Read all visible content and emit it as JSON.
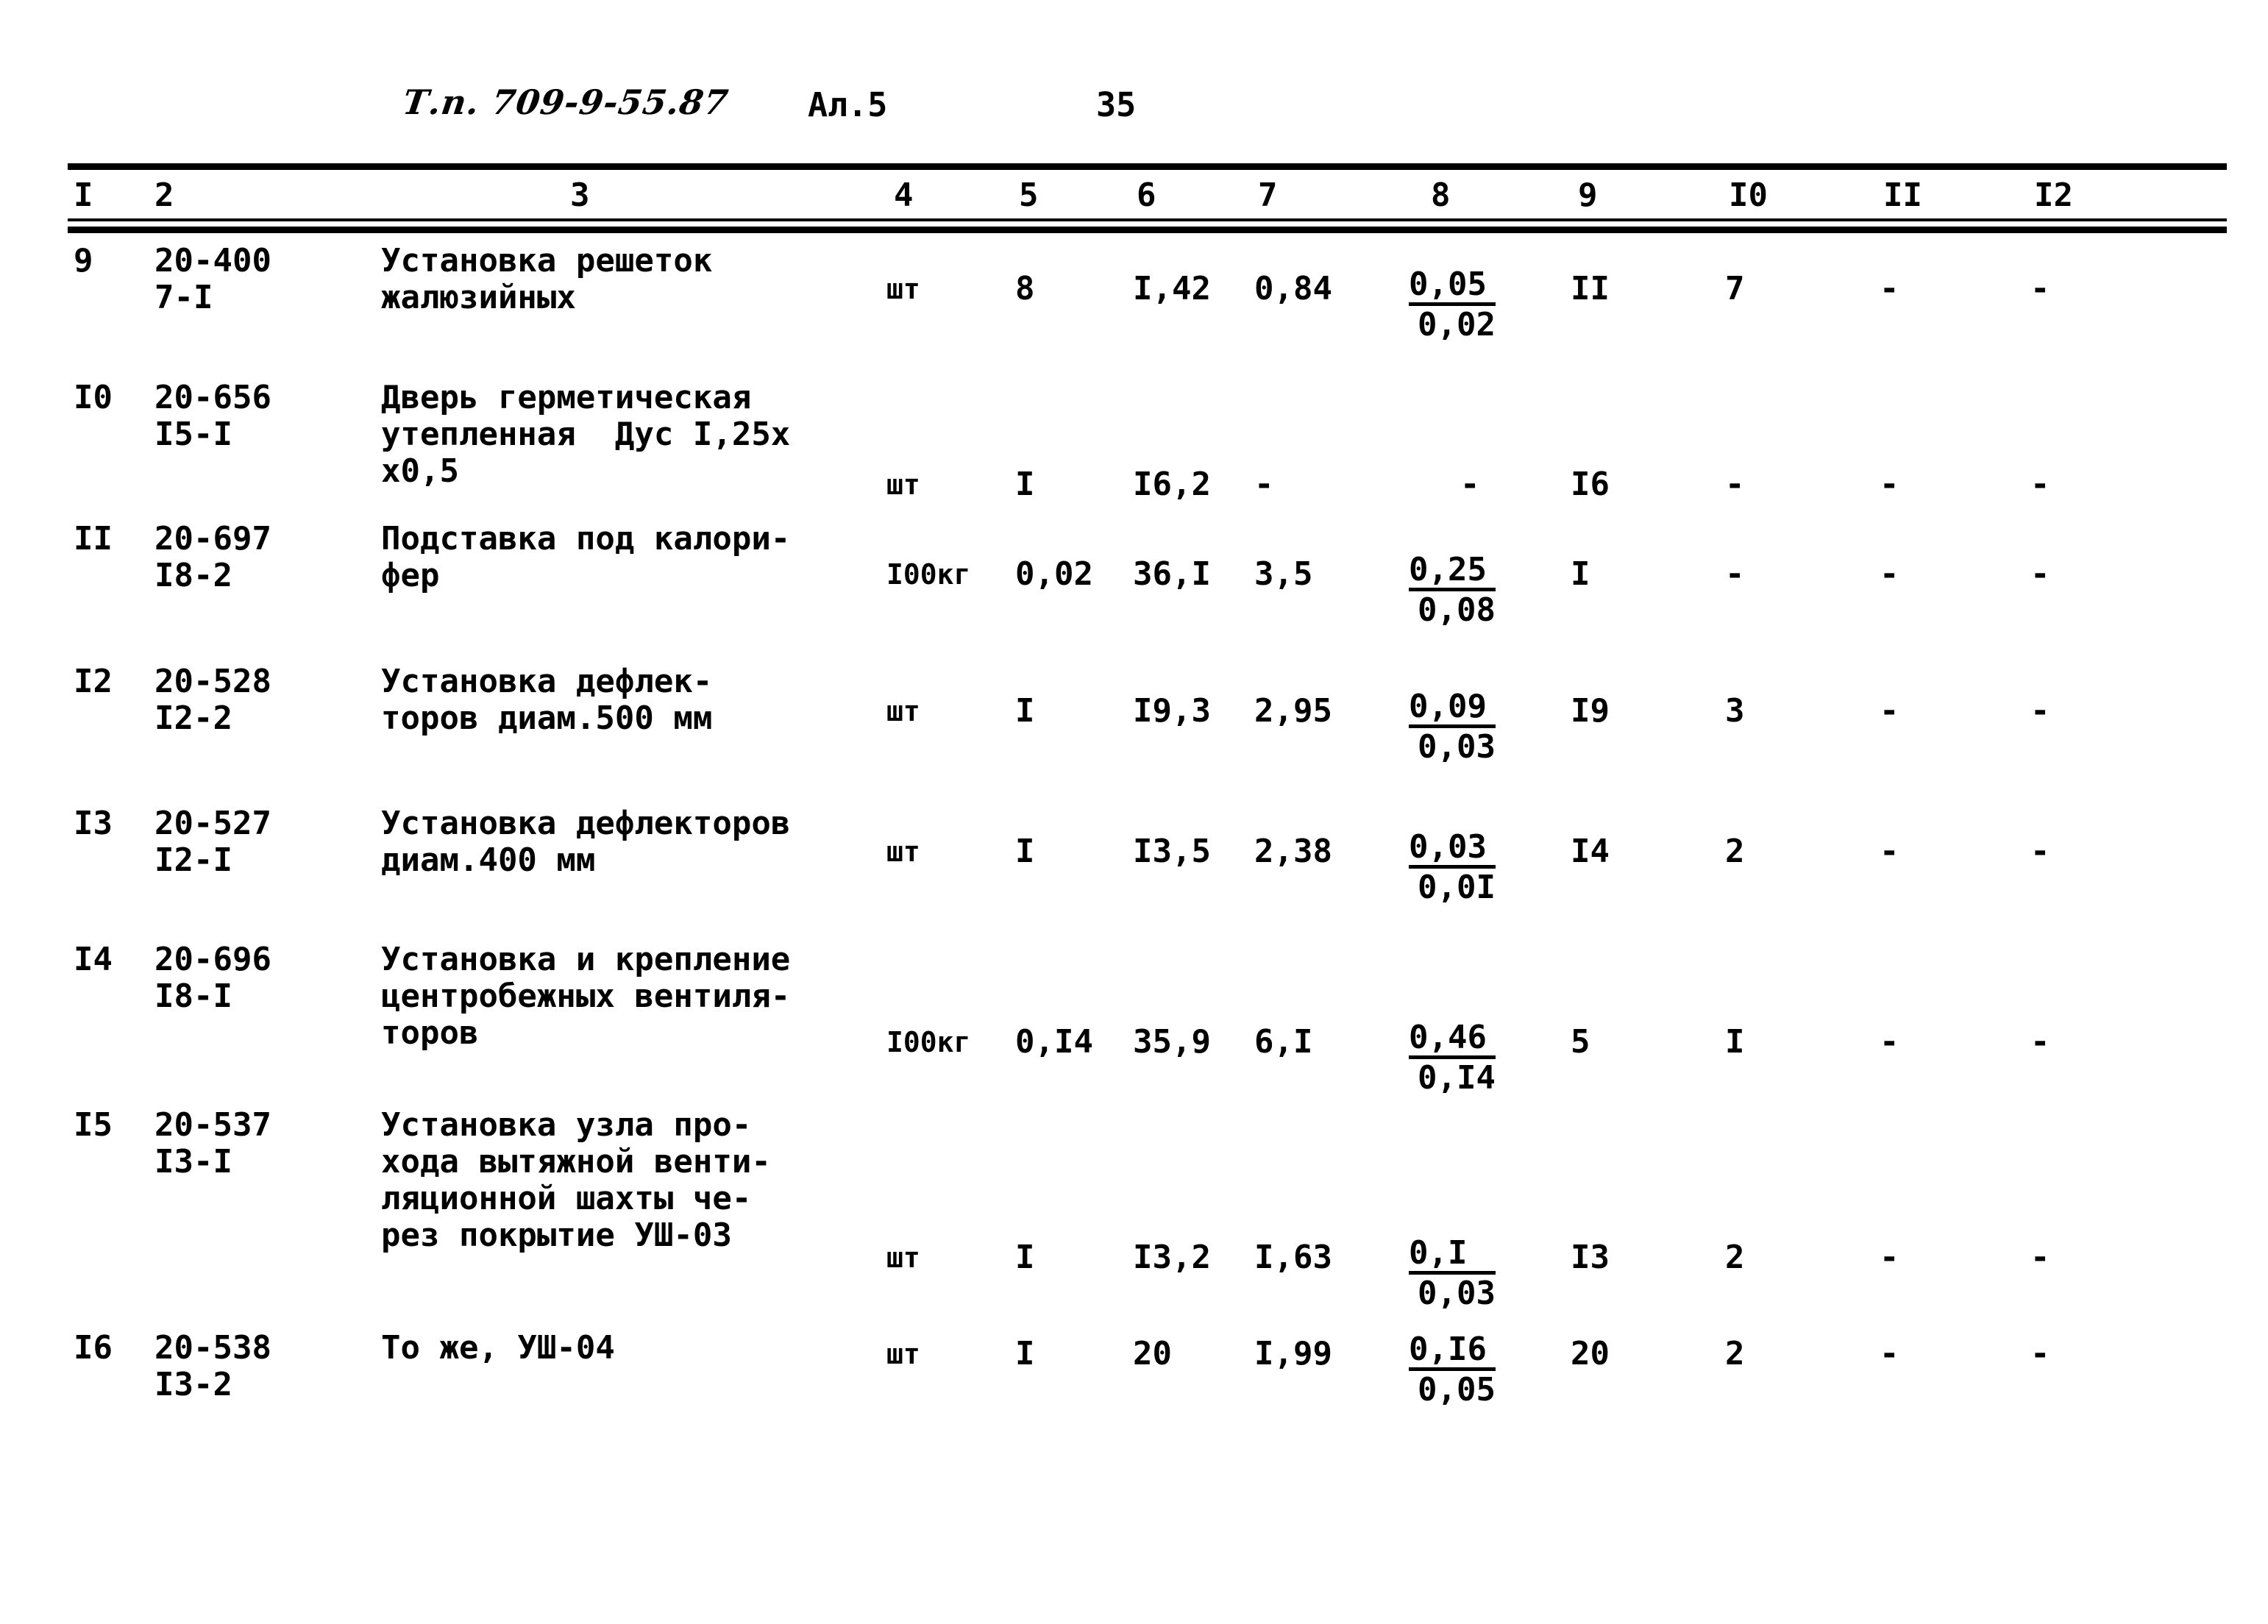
{
  "header": {
    "doc_code": "Т.п. 709-9-55.87",
    "album": "Ал.5",
    "page": "35"
  },
  "table": {
    "column_numbers": [
      "I",
      "2",
      "3",
      "4",
      "5",
      "6",
      "7",
      "8",
      "9",
      "I0",
      "II",
      "I2"
    ],
    "rows": [
      {
        "num": "9",
        "code": "20-400\n7-I",
        "desc": "Установка решеток\nжалюзийных",
        "unit": "шт",
        "qty": "8",
        "v6": "I,42",
        "v7": "0,84",
        "frac_num": "0,05",
        "frac_den": "0,02",
        "v9": "II",
        "v10": "7",
        "v11": "-",
        "v12": "-"
      },
      {
        "num": "I0",
        "code": "20-656\nI5-I",
        "desc": "Дверь герметическая\nутепленная  Дус I,25х\nх0,5",
        "unit": "шт",
        "qty": "I",
        "v6": "I6,2",
        "v7": "-",
        "frac_num": "",
        "frac_den": "",
        "v8_dash": "-",
        "v9": "I6",
        "v10": "-",
        "v11": "-",
        "v12": "-"
      },
      {
        "num": "II",
        "code": "20-697\nI8-2",
        "desc": "Подставка под калори-\nфер",
        "unit": "I00кг",
        "qty": "0,02",
        "v6": "36,I",
        "v7": "3,5",
        "frac_num": "0,25",
        "frac_den": "0,08",
        "v9": "I",
        "v10": "-",
        "v11": "-",
        "v12": "-"
      },
      {
        "num": "I2",
        "code": "20-528\nI2-2",
        "desc": "Установка дефлек-\nторов диам.500 мм",
        "unit": "шт",
        "qty": "I",
        "v6": "I9,3",
        "v7": "2,95",
        "frac_num": "0,09",
        "frac_den": "0,03",
        "v9": "I9",
        "v10": "3",
        "v11": "-",
        "v12": "-"
      },
      {
        "num": "I3",
        "code": "20-527\nI2-I",
        "desc": "Установка дефлекторов\nдиам.400 мм",
        "unit": "шт",
        "qty": "I",
        "v6": "I3,5",
        "v7": "2,38",
        "frac_num": "0,03",
        "frac_den": "0,0I",
        "v9": "I4",
        "v10": "2",
        "v11": "-",
        "v12": "-"
      },
      {
        "num": "I4",
        "code": "20-696\nI8-I",
        "desc": "Установка и крепление\nцентробежных вентиля-\nторов",
        "unit": "I00кг",
        "qty": "0,I4",
        "v6": "35,9",
        "v7": "6,I",
        "frac_num": "0,46",
        "frac_den": "0,I4",
        "v9": "5",
        "v10": "I",
        "v11": "-",
        "v12": "-"
      },
      {
        "num": "I5",
        "code": "20-537\nI3-I",
        "desc": "Установка узла про-\nхода вытяжной венти-\nляционной шахты че-\nрез покрытие УШ-03",
        "unit": "шт",
        "qty": "I",
        "v6": "I3,2",
        "v7": "I,63",
        "frac_num": "0,I",
        "frac_den": "0,03",
        "v9": "I3",
        "v10": "2",
        "v11": "-",
        "v12": "-"
      },
      {
        "num": "I6",
        "code": "20-538\nI3-2",
        "desc": "То же, УШ-04",
        "unit": "шт",
        "qty": "I",
        "v6": "20",
        "v7": "I,99",
        "frac_num": "0,I6",
        "frac_den": "0,05",
        "v9": "20",
        "v10": "2",
        "v11": "-",
        "v12": "-"
      }
    ]
  }
}
